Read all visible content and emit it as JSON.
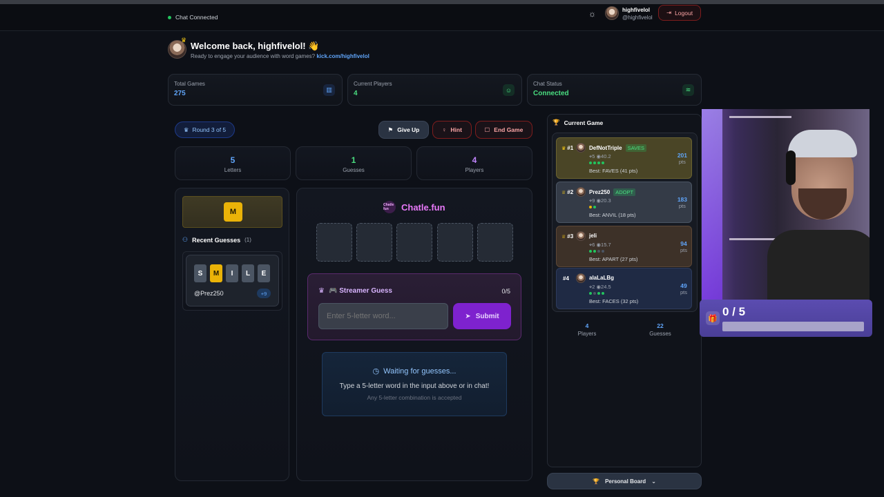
{
  "topbar": {
    "chat_status": "Chat Connected",
    "username": "highfivelol",
    "handle": "@highfivelol",
    "logout_label": "Logout"
  },
  "welcome": {
    "title": "Welcome back, highfivelol! 👋",
    "subtitle": "Ready to engage your audience with word games?",
    "link": "kick.com/highfivelol"
  },
  "stats": [
    {
      "label": "Total Games",
      "value": "275",
      "color": "#60a5fa",
      "icon": "bar-chart-icon"
    },
    {
      "label": "Current Players",
      "value": "4",
      "color": "#4ade80",
      "icon": "user-icon"
    },
    {
      "label": "Chat Status",
      "value": "Connected",
      "color": "#4ade80",
      "icon": "wifi-icon"
    }
  ],
  "game": {
    "round_label": "Round 3 of 5",
    "give_up_label": "Give Up",
    "hint_label": "Hint",
    "end_game_label": "End Game",
    "letters": {
      "value": "5",
      "label": "Letters",
      "color": "#60a5fa"
    },
    "guesses": {
      "value": "1",
      "label": "Guesses",
      "color": "#4ade80"
    },
    "players": {
      "value": "4",
      "label": "Players",
      "color": "#c084fc"
    }
  },
  "hint_letter": "M",
  "recent_guesses": {
    "title": "Recent Guesses",
    "count": "(1)",
    "items": [
      {
        "letters": [
          "S",
          "M",
          "I",
          "L",
          "E"
        ],
        "user": "@Prez250",
        "points": "+9"
      }
    ]
  },
  "board": {
    "logo_small": "Chatle fun",
    "brand": "Chatle.fun"
  },
  "streamer_guess": {
    "title": "🎮 Streamer Guess",
    "count": "0/5",
    "placeholder": "Enter 5-letter word...",
    "submit_label": "Submit"
  },
  "waiting": {
    "title": "Waiting for guesses...",
    "line1": "Type a 5-letter word in the input above or in chat!",
    "line2": "Any 5-letter combination is accepted"
  },
  "current_game": {
    "title": "Current Game",
    "players": [
      {
        "rank": "#1",
        "name": "DefNotTriple",
        "tag": "SAVES",
        "stats": "⌖5 ◉40.2",
        "best": "Best: FAVES (41 pts)",
        "pts": "201",
        "pts_label": "pts",
        "bg": "#4a4526",
        "border": "#6b6330",
        "dots": [
          "#22c55e",
          "#22c55e",
          "#22c55e",
          "#22c55e"
        ]
      },
      {
        "rank": "#2",
        "name": "Prez250",
        "tag": "ADOPT",
        "stats": "⌖9 ◉20.3",
        "best": "Best: ANVIL (18 pts)",
        "pts": "183",
        "pts_label": "pts",
        "bg": "#343b47",
        "border": "#4b5563",
        "dots": [
          "#eab308",
          "#22c55e"
        ]
      },
      {
        "rank": "#3",
        "name": "jeli",
        "tag": "",
        "stats": "⌖6 ◉15.7",
        "best": "Best: APART (27 pts)",
        "pts": "94",
        "pts_label": "pts",
        "bg": "#3d3128",
        "border": "#5c4736",
        "dots": [
          "#22c55e",
          "#22c55e",
          "#4b5563",
          "#4b5563"
        ]
      },
      {
        "rank": "#4",
        "name": "alaLaLBg",
        "tag": "",
        "stats": "⌖2 ◉24.5",
        "best": "Best: FACES (32 pts)",
        "pts": "49",
        "pts_label": "pts",
        "bg": "#1f2a44",
        "border": "#2e3b5c",
        "dots": [
          "#22c55e",
          "#4b5563",
          "#22c55e",
          "#22c55e"
        ]
      }
    ],
    "footer": [
      {
        "value": "4",
        "label": "Players"
      },
      {
        "value": "22",
        "label": "Guesses"
      }
    ],
    "personal_board_label": "Personal Board"
  },
  "overlay": {
    "progress_text": "0 / 5",
    "progress": 0
  }
}
